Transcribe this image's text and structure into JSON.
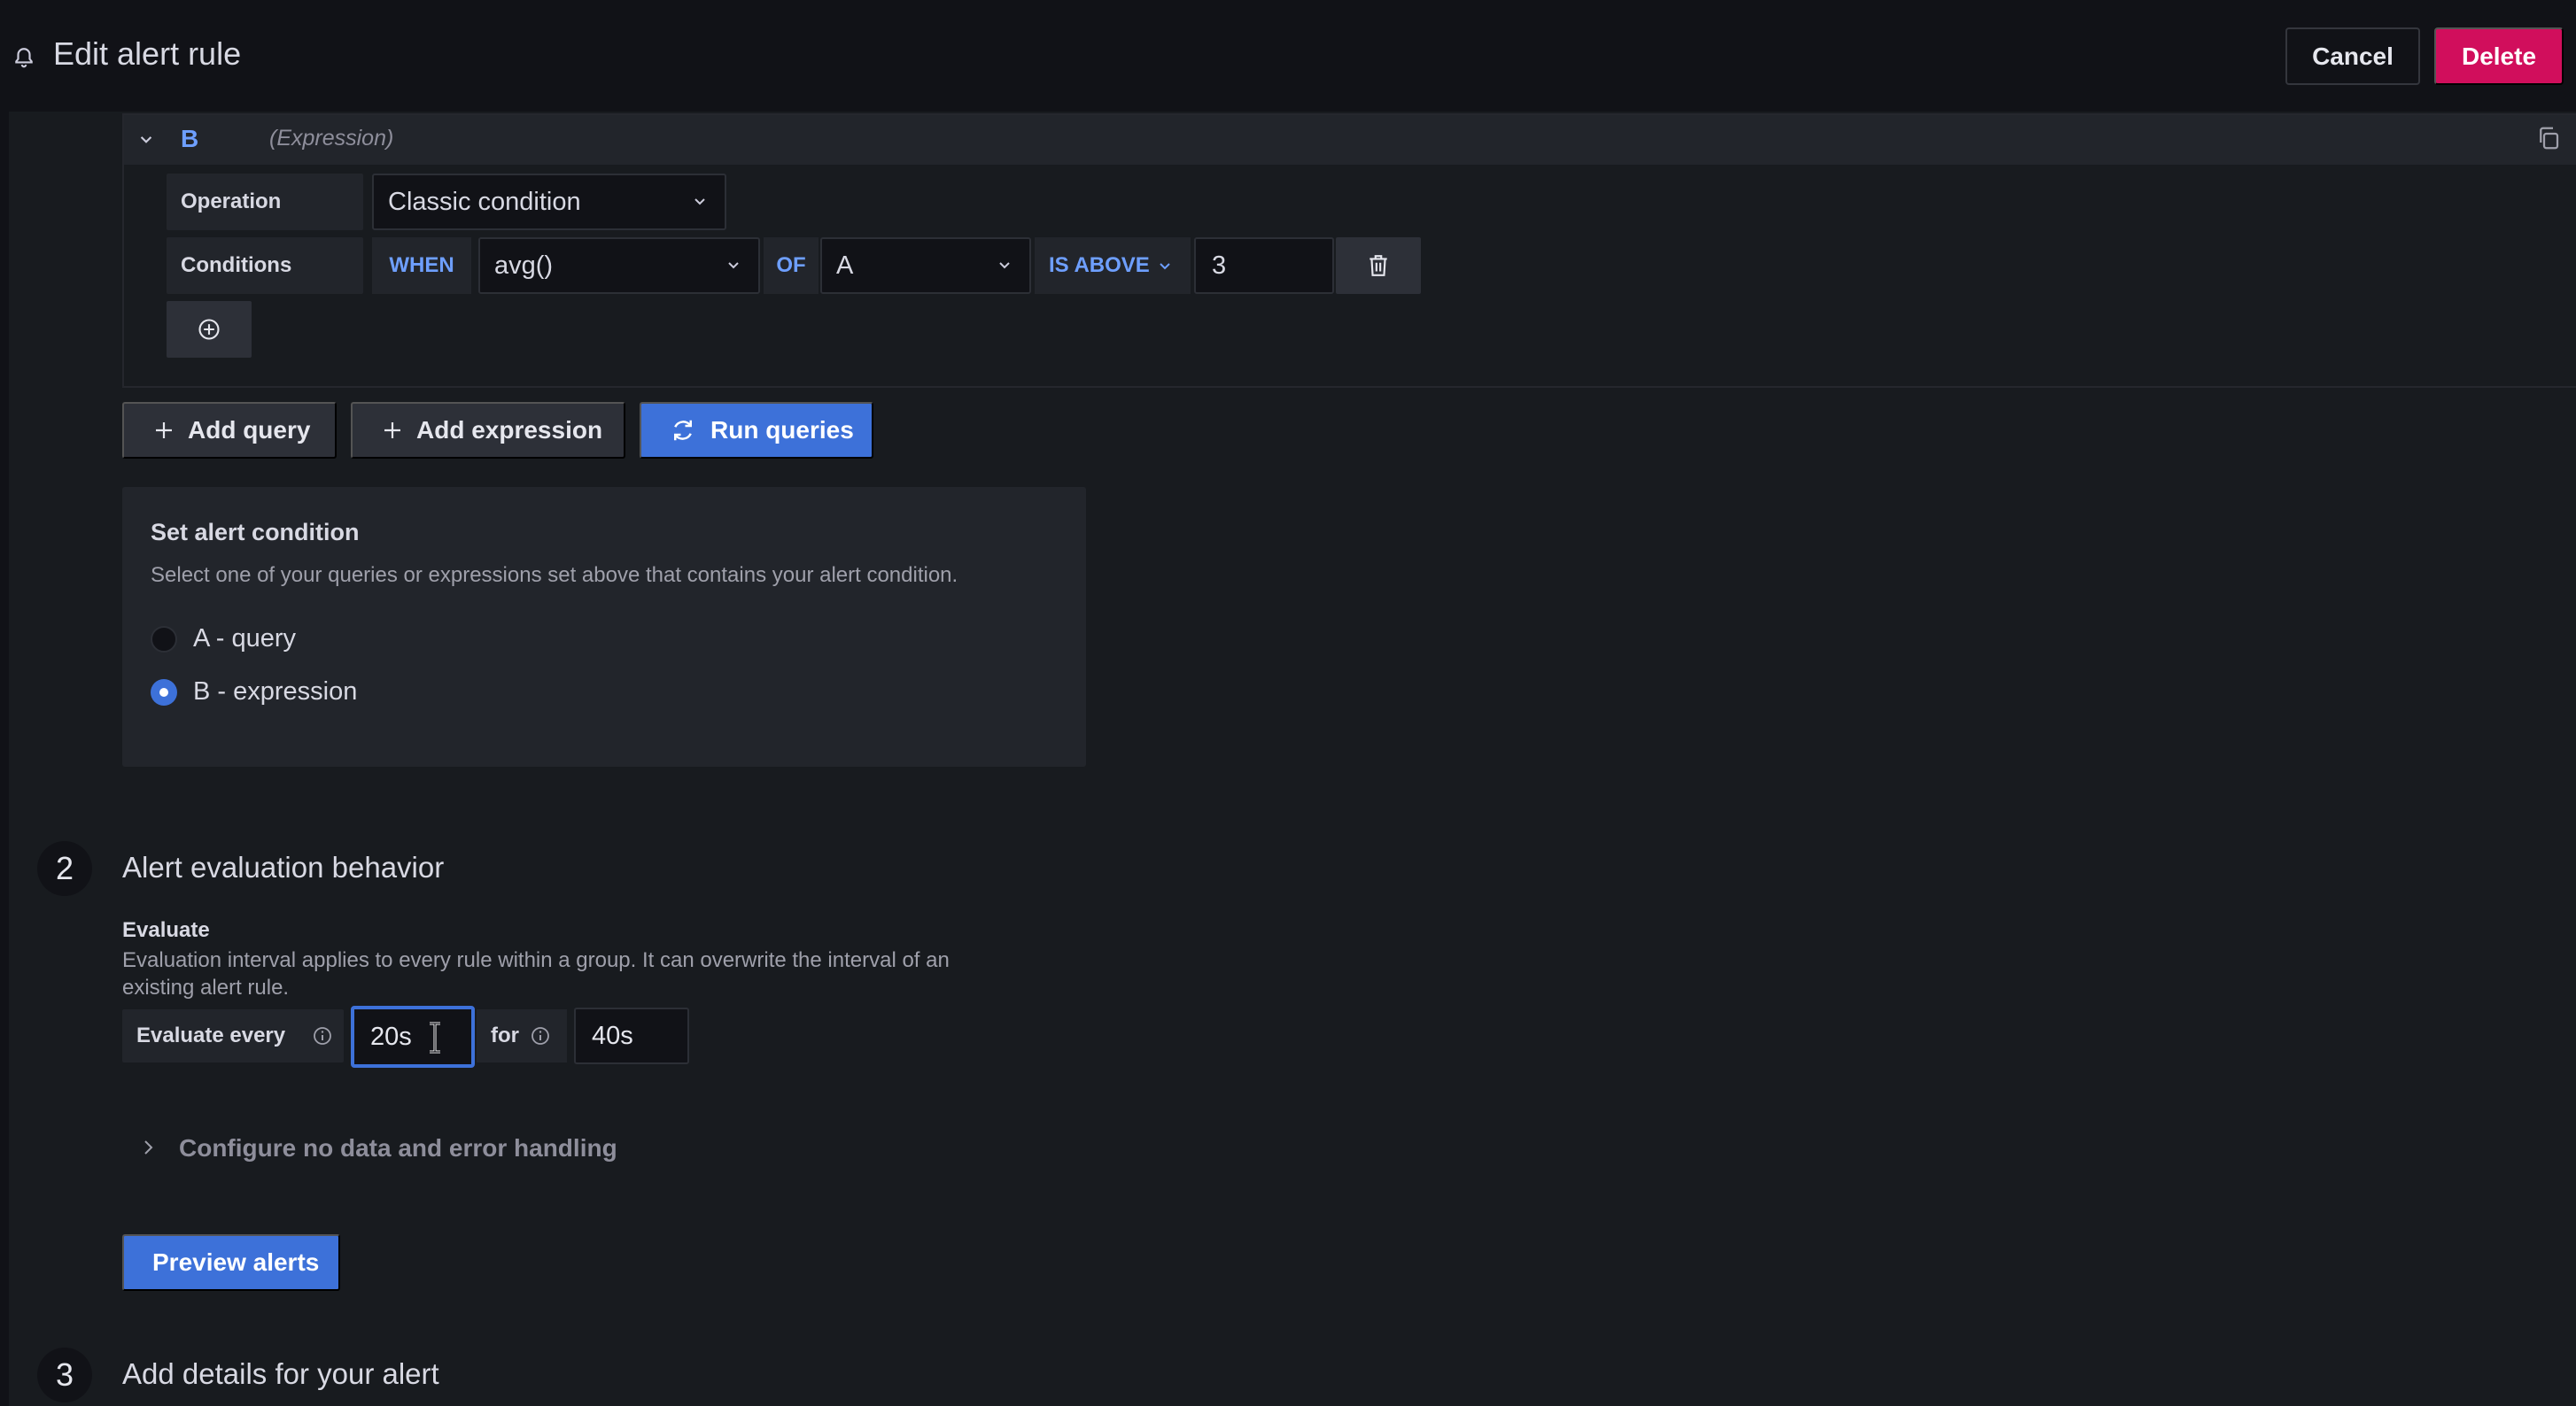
{
  "header": {
    "title": "Edit alert rule",
    "cancel_label": "Cancel",
    "delete_label": "Delete"
  },
  "expression": {
    "name": "B",
    "type_label": "(Expression)",
    "operation_label": "Operation",
    "operation_value": "Classic condition",
    "conditions_label": "Conditions",
    "when_label": "WHEN",
    "function_value": "avg()",
    "of_label": "OF",
    "query_value": "A",
    "evaluator_label": "IS ABOVE",
    "threshold_value": "3"
  },
  "toolbar": {
    "add_query_label": "Add query",
    "add_expression_label": "Add expression",
    "run_queries_label": "Run queries"
  },
  "alert_condition": {
    "title": "Set alert condition",
    "description": "Select one of your queries or expressions set above that contains your alert condition.",
    "options": [
      {
        "label": "A - query",
        "selected": false
      },
      {
        "label": "B - expression",
        "selected": true
      }
    ]
  },
  "evaluation": {
    "step_number": "2",
    "section_title": "Alert evaluation behavior",
    "evaluate_title": "Evaluate",
    "evaluate_description": "Evaluation interval applies to every rule within a group. It can overwrite the interval of an existing alert rule.",
    "evaluate_every_label": "Evaluate every",
    "evaluate_every_value": "20s",
    "for_label": "for",
    "for_value": "40s",
    "config_toggle_label": "Configure no data and error handling",
    "preview_label": "Preview alerts"
  },
  "details": {
    "step_number": "3",
    "section_title": "Add details for your alert"
  },
  "colors": {
    "background": "#111217",
    "panel": "#181b1f",
    "accent": "#3d71d9",
    "keyword": "#6e9fff",
    "danger": "#d10e5c"
  }
}
